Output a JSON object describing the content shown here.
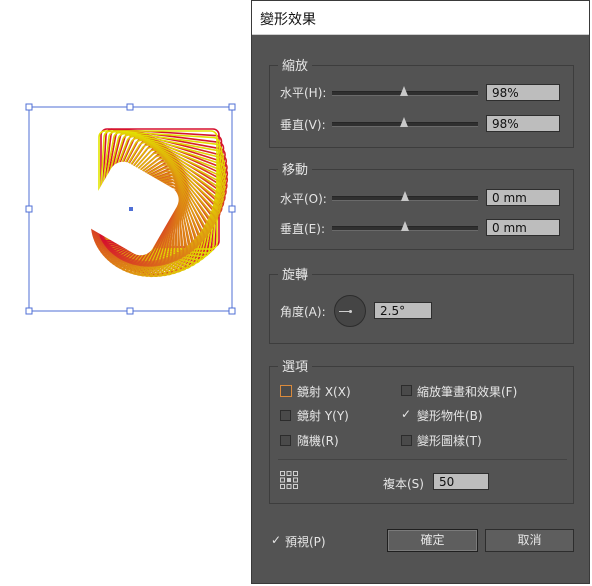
{
  "dialog": {
    "title": "變形效果",
    "scale": {
      "title": "縮放",
      "horizontal": {
        "label": "水平(H):",
        "value": "98%",
        "slider_fraction": 0.49
      },
      "vertical": {
        "label": "垂直(V):",
        "value": "98%",
        "slider_fraction": 0.49
      }
    },
    "move": {
      "title": "移動",
      "horizontal": {
        "label": "水平(O):",
        "value": "0 mm",
        "slider_fraction": 0.5
      },
      "vertical": {
        "label": "垂直(E):",
        "value": "0 mm",
        "slider_fraction": 0.5
      }
    },
    "rotate": {
      "title": "旋轉",
      "angle_label": "角度(A):",
      "angle_value": "2.5°"
    },
    "options": {
      "title": "選項",
      "reflect_x": {
        "label": "鏡射 X(X)",
        "checked": false
      },
      "reflect_y": {
        "label": "鏡射 Y(Y)",
        "checked": false
      },
      "random": {
        "label": "隨機(R)",
        "checked": false
      },
      "scale_strokes": {
        "label": "縮放筆畫和效果(F)",
        "checked": false
      },
      "transform_objects": {
        "label": "變形物件(B)",
        "checked": true
      },
      "transform_patterns": {
        "label": "變形圖樣(T)",
        "checked": false
      },
      "copies_label": "複本(S)",
      "copies_value": "50"
    },
    "preview": {
      "label": "預視(P)",
      "checked": true
    },
    "ok_label": "確定",
    "cancel_label": "取消"
  },
  "artwork": {
    "gradient_start": "#d5102e",
    "gradient_end": "#e3e400",
    "selection_color": "#4f6fd6",
    "copies": 50,
    "rotation_step_deg": 2.5,
    "scale_step": 0.98
  }
}
